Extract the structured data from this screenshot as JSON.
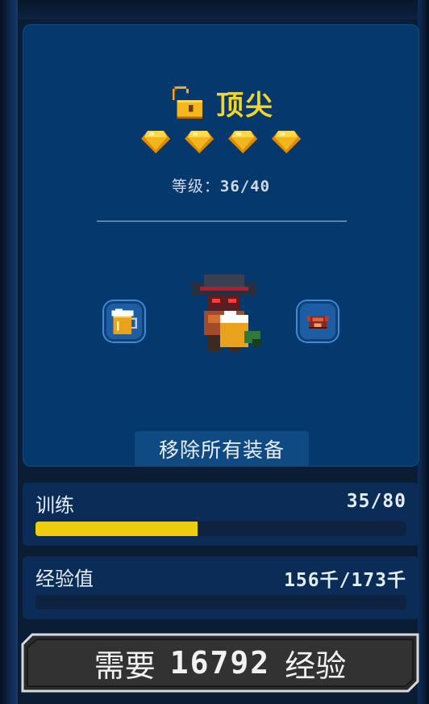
{
  "hero": {
    "rank_title": "顶尖",
    "gem_count": 4,
    "level_label": "等级：",
    "level_value": "36/40"
  },
  "equipment": {
    "left_slot_icon": "beer-mug-icon",
    "right_slot_icon": "red-armor-icon",
    "character_icon": "knight-character-icon",
    "remove_all_label": "移除所有装备"
  },
  "training": {
    "label": "训练",
    "value": "35/80",
    "progress": 0.4375
  },
  "experience": {
    "label": "经验值",
    "value": "156千/173千",
    "progress": 0.0
  },
  "need_button": {
    "prefix": "需要",
    "amount": "16792",
    "suffix": "经验"
  },
  "colors": {
    "accent_gold": "#f3d62a",
    "card_bg": "#05396d",
    "training_bar": "#eccd10"
  }
}
